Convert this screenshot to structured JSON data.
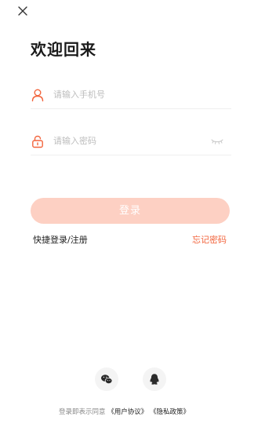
{
  "header": {
    "close_icon": "close-icon",
    "title": "欢迎回来"
  },
  "form": {
    "phone": {
      "icon": "user-icon",
      "placeholder": "请输入手机号",
      "value": ""
    },
    "password": {
      "icon": "lock-icon",
      "placeholder": "请输入密码",
      "value": "",
      "toggle_icon": "eye-closed-icon"
    },
    "login_label": "登录",
    "quick_register_label": "快捷登录/注册",
    "forgot_label": "忘记密码"
  },
  "social": [
    {
      "name": "wechat",
      "icon": "wechat-icon"
    },
    {
      "name": "qq",
      "icon": "qq-icon"
    }
  ],
  "agreement": {
    "prefix": "登录即表示同意",
    "user_agreement": "《用户协议》",
    "privacy_policy": "《隐私政策》"
  },
  "colors": {
    "accent": "#f2643c",
    "button_disabled": "#fdd0c3",
    "divider": "#efefef",
    "placeholder": "#bdbdbd"
  }
}
